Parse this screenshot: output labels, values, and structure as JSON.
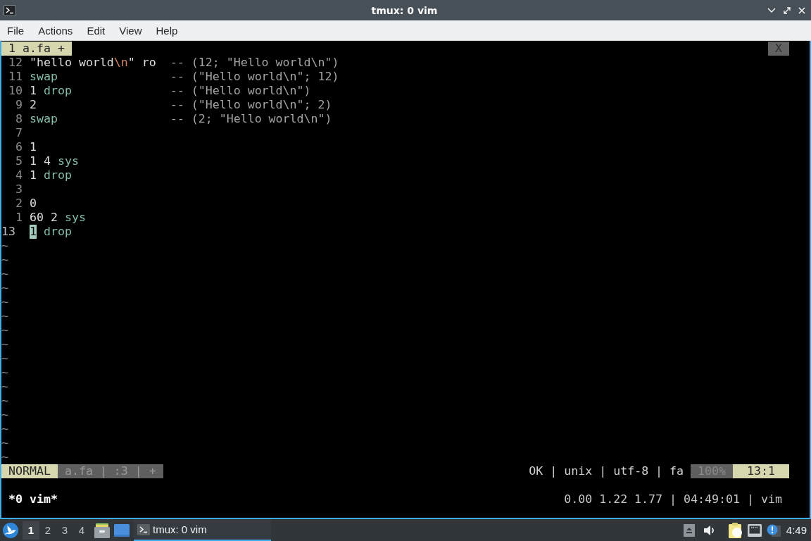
{
  "window": {
    "title": "tmux: 0 vim"
  },
  "menu": [
    "File",
    "Actions",
    "Edit",
    "View",
    "Help"
  ],
  "vim": {
    "tabline": {
      "tabs": [
        {
          "label": "1 a.fa +",
          "selected": true
        }
      ],
      "close": "X"
    },
    "lines": [
      {
        "number": "12",
        "current": false,
        "code": [
          [
            {
              "text": "\"hello world",
              "kind": "string"
            },
            {
              "text": "\\n",
              "kind": "escape"
            },
            {
              "text": "\"",
              "kind": "string"
            }
          ],
          [
            {
              "text": "ro",
              "kind": "plain"
            }
          ]
        ],
        "comment": "-- (12; \"Hello world\\n\")"
      },
      {
        "number": "11",
        "current": false,
        "code": [
          [
            {
              "text": "swap",
              "kind": "word"
            }
          ]
        ],
        "comment": "-- (\"Hello world\\n\"; 12)"
      },
      {
        "number": "10",
        "current": false,
        "code": [
          [
            {
              "text": "1",
              "kind": "number"
            }
          ],
          [
            {
              "text": "drop",
              "kind": "word"
            }
          ]
        ],
        "comment": "-- (\"Hello world\\n\")"
      },
      {
        "number": "9",
        "current": false,
        "code": [
          [
            {
              "text": "2",
              "kind": "number"
            }
          ]
        ],
        "comment": "-- (\"Hello world\\n\"; 2)"
      },
      {
        "number": "8",
        "current": false,
        "code": [
          [
            {
              "text": "swap",
              "kind": "word"
            }
          ]
        ],
        "comment": "-- (2; \"Hello world\\n\")"
      },
      {
        "number": "7",
        "current": false
      },
      {
        "number": "6",
        "current": false,
        "code": [
          [
            {
              "text": "1",
              "kind": "number"
            }
          ]
        ]
      },
      {
        "number": "5",
        "current": false,
        "code": [
          [
            {
              "text": "1",
              "kind": "number"
            }
          ],
          [
            {
              "text": "4",
              "kind": "number"
            }
          ],
          [
            {
              "text": "sys",
              "kind": "word"
            }
          ]
        ]
      },
      {
        "number": "4",
        "current": false,
        "code": [
          [
            {
              "text": "1",
              "kind": "number"
            }
          ],
          [
            {
              "text": "drop",
              "kind": "word"
            }
          ]
        ]
      },
      {
        "number": "3",
        "current": false
      },
      {
        "number": "2",
        "current": false,
        "code": [
          [
            {
              "text": "0",
              "kind": "number"
            }
          ]
        ]
      },
      {
        "number": "1",
        "current": false,
        "code": [
          [
            {
              "text": "60",
              "kind": "number"
            }
          ],
          [
            {
              "text": "2",
              "kind": "number"
            }
          ],
          [
            {
              "text": "sys",
              "kind": "word"
            }
          ]
        ]
      },
      {
        "number": "13",
        "current": true,
        "code": [
          [
            {
              "text": "1",
              "kind": "cursor"
            }
          ],
          [
            {
              "text": "drop",
              "kind": "word"
            }
          ]
        ]
      }
    ],
    "filler": [
      "~",
      "~",
      "~",
      "~",
      "~",
      "~",
      "~",
      "~",
      "~",
      "~",
      "~",
      "~",
      "~",
      "~",
      "~",
      "~"
    ],
    "statusline": {
      "mode": "NORMAL",
      "file": "a.fa | :3 | +",
      "info": "OK | unix | utf-8 | fa",
      "percent": "100%",
      "position": "13:1"
    }
  },
  "tmux_status": {
    "windows": [
      {
        "label": "*0 vim*",
        "selected": true
      }
    ],
    "right": "0.00 1.22 1.77 | 04:49:01 | vim"
  },
  "taskbar": {
    "desktops": [
      {
        "label": "1",
        "selected": true
      },
      {
        "label": "2",
        "selected": false
      },
      {
        "label": "3",
        "selected": false
      },
      {
        "label": "4",
        "selected": false
      }
    ],
    "tasks": [
      {
        "label": "tmux: 0 vim",
        "selected": true
      }
    ],
    "clock": "4:49"
  }
}
